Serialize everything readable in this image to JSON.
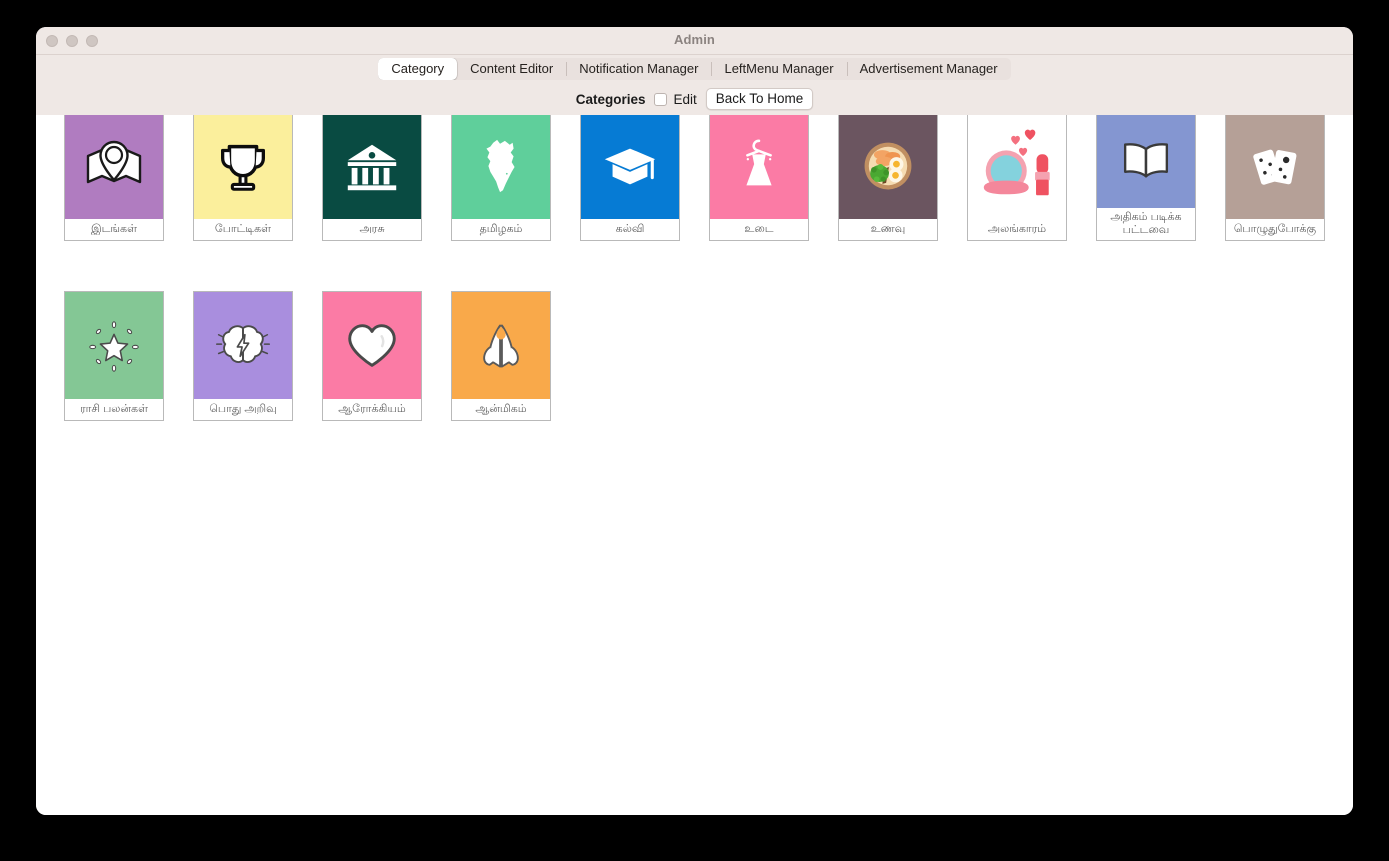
{
  "window": {
    "title": "Admin",
    "traffic_lights": [
      "close-button",
      "minimize-button",
      "zoom-button"
    ]
  },
  "tabs": [
    {
      "label": "Category",
      "selected": true
    },
    {
      "label": "Content Editor",
      "selected": false
    },
    {
      "label": "Notification Manager",
      "selected": false
    },
    {
      "label": "LeftMenu Manager",
      "selected": false
    },
    {
      "label": "Advertisement Manager",
      "selected": false
    }
  ],
  "toolbar": {
    "section_title": "Categories",
    "edit_label": "Edit",
    "edit_checked": false,
    "back_home_label": "Back To Home"
  },
  "categories": {
    "rows": [
      [
        {
          "label": "இடங்கள்",
          "icon": "map-pin-icon",
          "bg": "#b07cc0",
          "two_line": false
        },
        {
          "label": "போட்டிகள்",
          "icon": "trophy-icon",
          "bg": "#fbef9c",
          "two_line": false
        },
        {
          "label": "அரசு",
          "icon": "government-building-icon",
          "bg": "#094b42",
          "two_line": false
        },
        {
          "label": "தமிழகம்",
          "icon": "tamilnadu-map-icon",
          "bg": "#5fcf9b",
          "two_line": false
        },
        {
          "label": "கல்வி",
          "icon": "graduation-cap-icon",
          "bg": "#067bd4",
          "two_line": false
        },
        {
          "label": "உடை",
          "icon": "dress-icon",
          "bg": "#fb7ba5",
          "two_line": false
        },
        {
          "label": "உணவு",
          "icon": "food-bowl-icon",
          "bg": "#6b5560",
          "two_line": false
        },
        {
          "label": "அலங்காரம்",
          "icon": "makeup-mirror-lipstick-icon",
          "bg": "#ffffff",
          "two_line": false
        },
        {
          "label": "அதிகம் படிக்க பட்டவை",
          "icon": "open-book-icon",
          "bg": "#8496d1",
          "two_line": true
        },
        {
          "label": "பொழுதுபோக்கு",
          "icon": "playing-cards-icon",
          "bg": "#b5a097",
          "two_line": false
        }
      ],
      [
        {
          "label": "ராசி பலன்கள்",
          "icon": "shining-star-icon",
          "bg": "#84c795",
          "two_line": false
        },
        {
          "label": "பொது அறிவு",
          "icon": "brain-lightning-icon",
          "bg": "#a98ede",
          "two_line": false
        },
        {
          "label": "ஆரோக்கியம்",
          "icon": "heart-icon",
          "bg": "#fb7ba5",
          "two_line": false
        },
        {
          "label": "ஆன்மிகம்",
          "icon": "praying-hands-icon",
          "bg": "#f9a94a",
          "two_line": false
        }
      ]
    ]
  },
  "colors": {
    "window_chrome": "#efe8e5",
    "content_bg": "#ffffff",
    "tile_border": "#b9b9b9",
    "label_text": "#5b5b5b"
  }
}
